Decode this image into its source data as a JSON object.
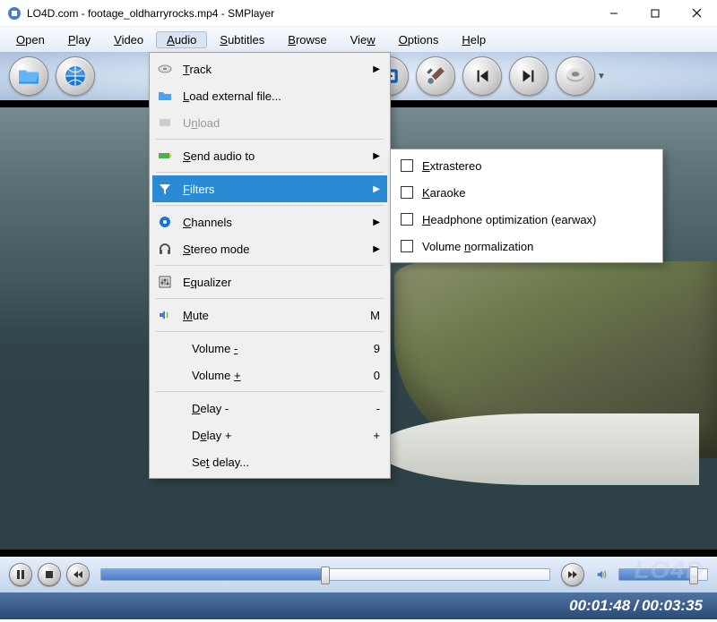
{
  "titlebar": {
    "title": "LO4D.com - footage_oldharryrocks.mp4 - SMPlayer"
  },
  "menubar": {
    "items": [
      {
        "label": "Open",
        "u": 0
      },
      {
        "label": "Play",
        "u": 0
      },
      {
        "label": "Video",
        "u": 0
      },
      {
        "label": "Audio",
        "u": 0,
        "active": true
      },
      {
        "label": "Subtitles",
        "u": 0
      },
      {
        "label": "Browse",
        "u": 0
      },
      {
        "label": "View",
        "u": 3
      },
      {
        "label": "Options",
        "u": 0
      },
      {
        "label": "Help",
        "u": 0
      }
    ]
  },
  "dropdown": {
    "items": [
      {
        "label": "Track",
        "u": 0,
        "arrow": true,
        "icon": "disc"
      },
      {
        "label": "Load external file...",
        "u": 0,
        "icon": "folder"
      },
      {
        "label": "Unload",
        "u": 1,
        "disabled": true,
        "icon": "unload"
      },
      {
        "sep": true
      },
      {
        "label": "Send audio to",
        "u": 0,
        "arrow": true,
        "icon": "soundcard"
      },
      {
        "sep": true
      },
      {
        "label": "Filters",
        "u": 0,
        "arrow": true,
        "highlight": true,
        "icon": "filter"
      },
      {
        "sep": true
      },
      {
        "label": "Channels",
        "u": 0,
        "arrow": true,
        "icon": "channels"
      },
      {
        "label": "Stereo mode",
        "u": 0,
        "arrow": true,
        "icon": "headphones"
      },
      {
        "sep": true
      },
      {
        "label": "Equalizer",
        "u": 1,
        "icon": "eq"
      },
      {
        "sep": true
      },
      {
        "label": "Mute",
        "u": 0,
        "shortcut": "M",
        "icon": "mute"
      },
      {
        "sep": true
      },
      {
        "label": "Volume -",
        "u": 7,
        "shortcut": "9",
        "indent": true
      },
      {
        "label": "Volume +",
        "u": 7,
        "shortcut": "0",
        "indent": true
      },
      {
        "sep": true
      },
      {
        "label": "Delay -",
        "u": 0,
        "shortcut": "-",
        "indent": true
      },
      {
        "label": "Delay +",
        "u": 1,
        "shortcut": "+",
        "indent": true
      },
      {
        "label": "Set delay...",
        "u": 2,
        "indent": true
      }
    ]
  },
  "submenu": {
    "items": [
      {
        "label": "Extrastereo",
        "u": 0
      },
      {
        "label": "Karaoke",
        "u": 0
      },
      {
        "label": "Headphone optimization (earwax)",
        "u": 0
      },
      {
        "label": "Volume normalization",
        "u": 7
      }
    ]
  },
  "status": {
    "current": "00:01:48",
    "total": "00:03:35"
  },
  "watermark": "LO4D"
}
